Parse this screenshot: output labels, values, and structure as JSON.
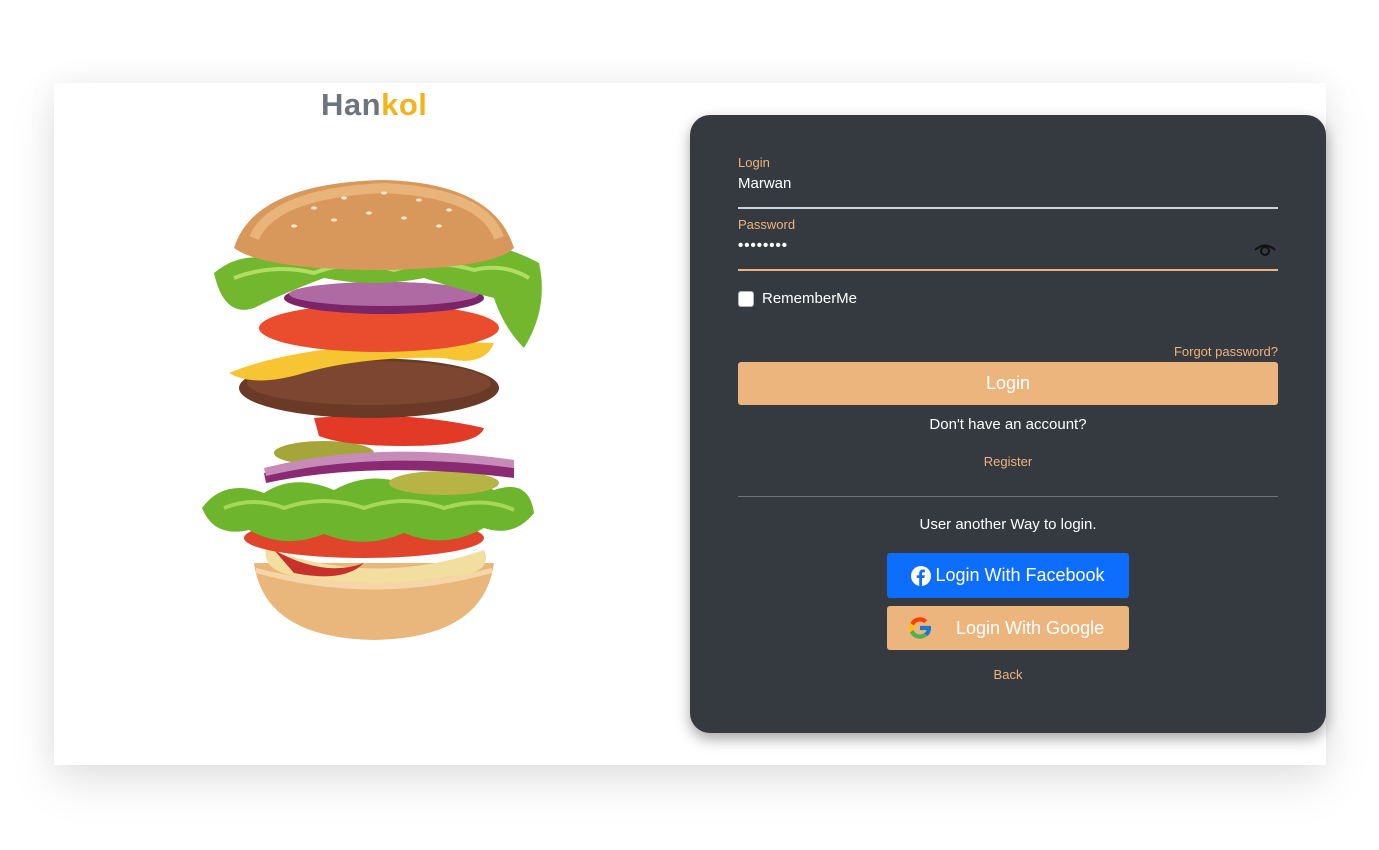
{
  "brand": {
    "part1": "Han",
    "part2": "kol",
    "color_gray": "#6c757d",
    "color_yellow": "#f4b31c"
  },
  "hero_image": {
    "alt": "burger-illustration"
  },
  "form": {
    "login_label": "Login",
    "login_value": "Marwan",
    "password_label": "Password",
    "password_value": "••••••••",
    "show_password_icon": "eye-icon",
    "remember_me": {
      "label": "RememberMe",
      "checked": false
    },
    "forgot_password": "Forgot password?",
    "login_button": "Login",
    "no_account_text": "Don't have an account?",
    "register_link": "Register",
    "other_way_text": "User another Way to login.",
    "facebook_button": "Login With Facebook",
    "google_button": "Login With Google",
    "back_link": "Back"
  },
  "colors": {
    "panel_bg": "#343a40",
    "accent": "#f0b27a",
    "button_accent": "#edb57e",
    "facebook_blue": "#0d6efd"
  }
}
